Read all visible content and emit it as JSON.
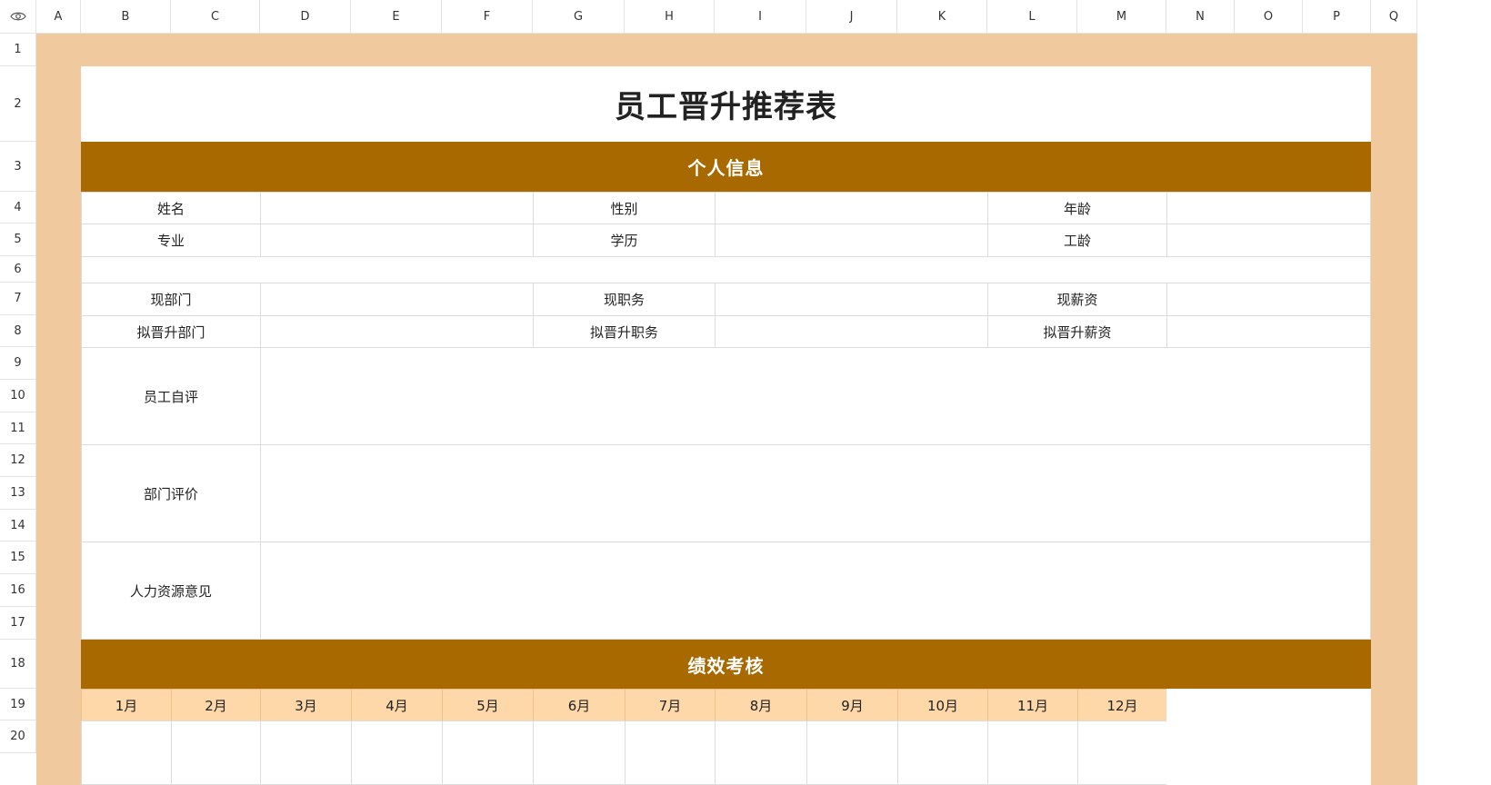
{
  "columns": [
    "A",
    "B",
    "C",
    "D",
    "E",
    "F",
    "G",
    "H",
    "I",
    "J",
    "K",
    "L",
    "M",
    "N",
    "O",
    "P",
    "Q"
  ],
  "rows": [
    "1",
    "2",
    "3",
    "4",
    "5",
    "6",
    "7",
    "8",
    "9",
    "10",
    "11",
    "12",
    "13",
    "14",
    "15",
    "16",
    "17",
    "18",
    "19",
    "20"
  ],
  "sheet": {
    "title": "员工晋升推荐表",
    "section_personal": "个人信息",
    "section_performance": "绩效考核",
    "labels": {
      "name": "姓名",
      "gender": "性别",
      "age": "年龄",
      "major": "专业",
      "education": "学历",
      "seniority": "工龄",
      "current_dept": "现部门",
      "current_position": "现职务",
      "current_salary": "现薪资",
      "proposed_dept": "拟晋升部门",
      "proposed_position": "拟晋升职务",
      "proposed_salary": "拟晋升薪资",
      "self_eval": "员工自评",
      "dept_eval": "部门评价",
      "hr_opinion": "人力资源意见"
    },
    "months": [
      "1月",
      "2月",
      "3月",
      "4月",
      "5月",
      "6月",
      "7月",
      "8月",
      "9月",
      "10月",
      "11月",
      "12月"
    ]
  },
  "colors": {
    "frame": "#f0c99e",
    "section": "#a86a00",
    "month_fill": "#fed8a8"
  },
  "icons": {
    "corner": "eye-icon"
  }
}
